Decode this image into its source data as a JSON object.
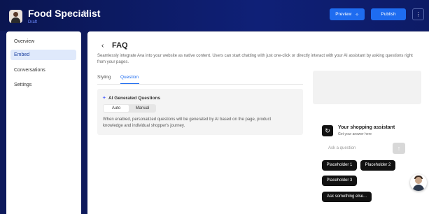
{
  "header": {
    "app_title": "Food Specialist",
    "status": "Draft",
    "preview_label": "Preview",
    "publish_label": "Publish",
    "more_icon": "more-vertical-icon",
    "edit_icon": "pencil-icon"
  },
  "sidebar": {
    "items": [
      {
        "label": "Overview",
        "active": false
      },
      {
        "label": "Embed",
        "active": true
      },
      {
        "label": "Conversations",
        "active": false
      },
      {
        "label": "Settings",
        "active": false
      }
    ]
  },
  "main": {
    "title": "FAQ",
    "description": "Seamlessly integrate Ava into your website as native content. Users can start chatting with just one-click or directly interact with your AI assistant by asking questions right from your pages.",
    "tabs": [
      {
        "label": "Styling",
        "active": false
      },
      {
        "label": "Question",
        "active": true
      }
    ],
    "panel": {
      "title": "AI Generated Questions",
      "options": [
        "Auto",
        "Manual"
      ],
      "selected": "Auto",
      "description": "When enabled, personalized questions will be generated by AI based on the page, product knowledge and individual shopper's journey."
    }
  },
  "preview": {
    "assistant_title": "Your shopping assistant",
    "assistant_subtitle": "Get your answer here",
    "input_placeholder": "Ask a question",
    "chips": [
      "Placeholder 1",
      "Placeholder 2",
      "Placeholder 3",
      "Ask something else..."
    ]
  },
  "colors": {
    "header_bg": "#0f2077",
    "accent": "#1e6cf0",
    "active_nav_bg": "#dfe9fb"
  }
}
